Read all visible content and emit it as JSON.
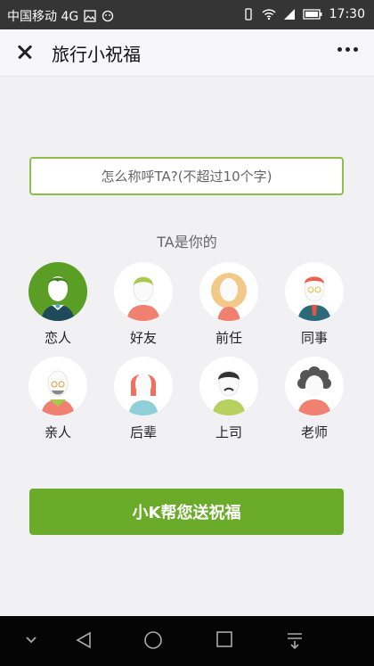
{
  "status_bar": {
    "carrier": "中国移动 4G",
    "time": "17:30",
    "icons": [
      "image-icon",
      "wechat-icon",
      "vibrate-icon",
      "wifi-icon",
      "signal-icon",
      "battery-icon"
    ]
  },
  "title_bar": {
    "title": "旅行小祝福",
    "icons": [
      "close-icon",
      "more-icon"
    ]
  },
  "form": {
    "name_placeholder": "怎么称呼TA?(不超过10个字)",
    "prompt": "TA是你的"
  },
  "relations": [
    {
      "label": "恋人",
      "selected": true,
      "icon": "lover-avatar-icon"
    },
    {
      "label": "好友",
      "selected": false,
      "icon": "friend-avatar-icon"
    },
    {
      "label": "前任",
      "selected": false,
      "icon": "ex-avatar-icon"
    },
    {
      "label": "同事",
      "selected": false,
      "icon": "colleague-avatar-icon"
    },
    {
      "label": "亲人",
      "selected": false,
      "icon": "family-avatar-icon"
    },
    {
      "label": "后辈",
      "selected": false,
      "icon": "junior-avatar-icon"
    },
    {
      "label": "上司",
      "selected": false,
      "icon": "boss-avatar-icon"
    },
    {
      "label": "老师",
      "selected": false,
      "icon": "teacher-avatar-icon"
    }
  ],
  "submit_label": "小K帮您送祝福",
  "colors": {
    "accent": "#6aac2a",
    "selected": "#5b9e26",
    "input_border": "#8cc04b"
  },
  "nav_icons": [
    "chevron-down-icon",
    "back-icon",
    "home-icon",
    "recent-apps-icon",
    "notification-icon"
  ]
}
